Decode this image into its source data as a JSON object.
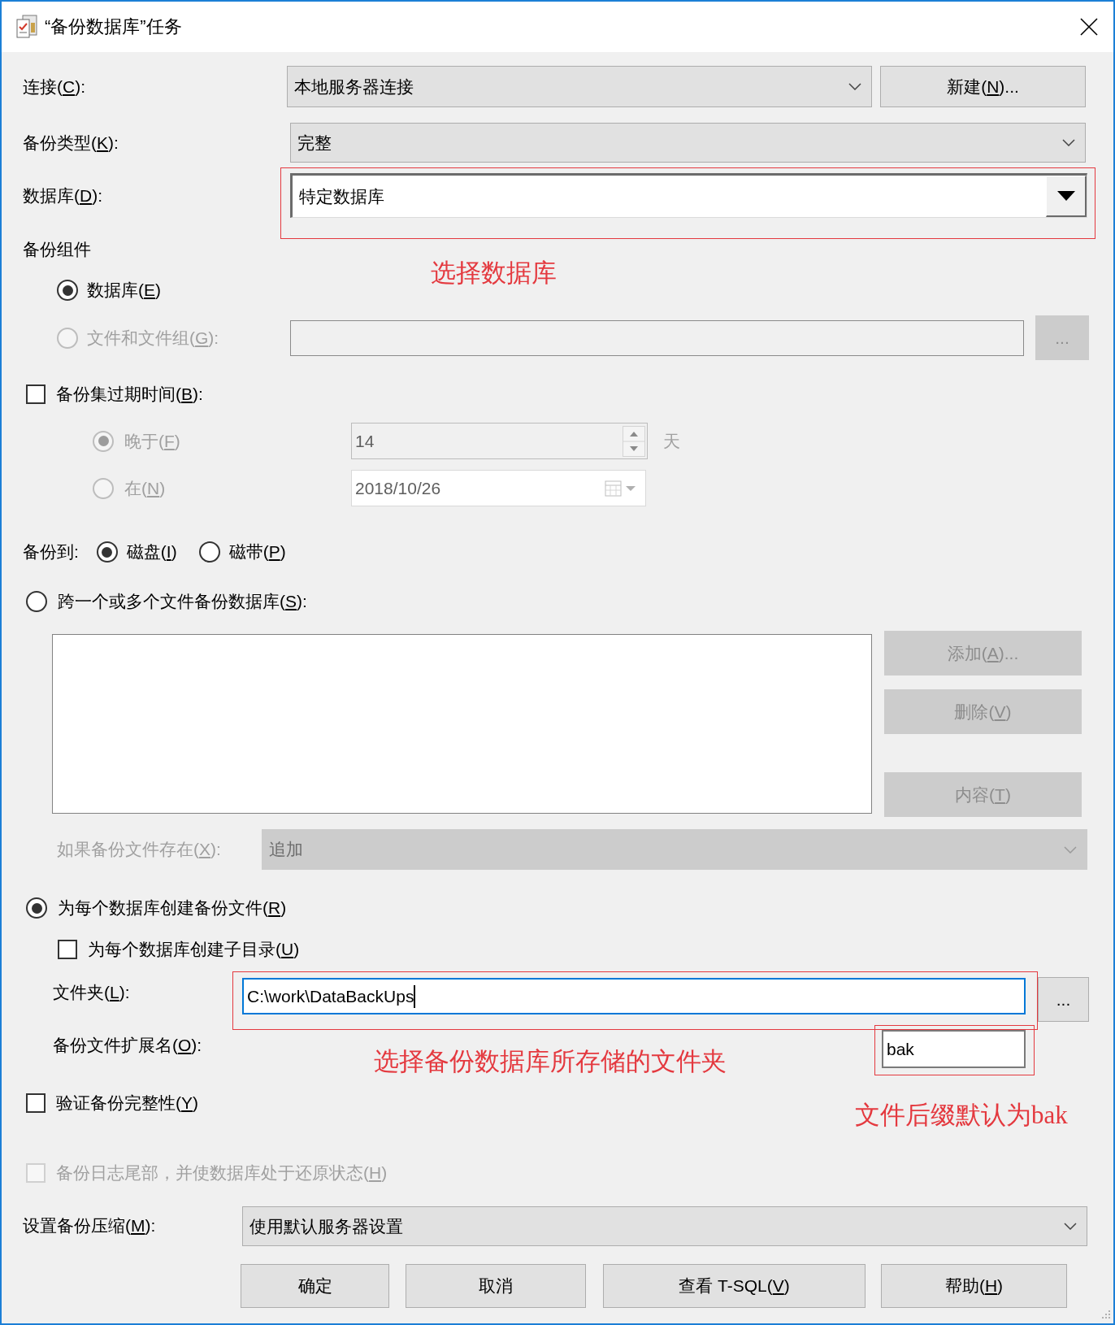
{
  "window": {
    "title": "“备份数据库”任务"
  },
  "connection": {
    "label": "连接(C):",
    "value": "本地服务器连接",
    "button": "新建(N)..."
  },
  "backup_type": {
    "label": "备份类型(K):",
    "value": "完整"
  },
  "database": {
    "label": "数据库(D):",
    "value": "特定数据库",
    "note": "选择数据库"
  },
  "backup_component": {
    "heading": "备份组件",
    "options": [
      {
        "label": "数据库(E)",
        "selected": true,
        "disabled": false
      },
      {
        "label": "文件和文件组(G):",
        "selected": false,
        "disabled": true
      }
    ],
    "browse_button": {
      "text": "...",
      "disabled": true
    }
  },
  "expiration": {
    "label": "备份集过期时间(B):",
    "checked": false,
    "options": [
      {
        "kind": "spinner",
        "label": "晚于(F)",
        "selected": true,
        "disabled": true,
        "value": "14",
        "unit": "天"
      },
      {
        "kind": "date",
        "label": "在(N)",
        "selected": false,
        "disabled": true,
        "value": "2018/10/26"
      }
    ]
  },
  "backup_to": {
    "label": "备份到:",
    "options": [
      {
        "label": "磁盘(I)",
        "selected": true
      },
      {
        "label": "磁带(P)",
        "selected": false
      }
    ]
  },
  "span_files": {
    "label": "跨一个或多个文件备份数据库(S):",
    "selected": false,
    "buttons": [
      {
        "text": "添加(A)...",
        "disabled": true
      },
      {
        "text": "删除(V)",
        "disabled": true
      },
      {
        "text": "内容(T)",
        "disabled": true
      }
    ],
    "if_exists": {
      "label": "如果备份文件存在(X):",
      "value": "追加",
      "disabled": true
    }
  },
  "per_database": {
    "label": "为每个数据库创建备份文件(R)",
    "selected": true,
    "subdirectory": {
      "label": "为每个数据库创建子目录(U)",
      "checked": false
    },
    "folder": {
      "label": "文件夹(L):",
      "value": "C:\\work\\DataBackUps",
      "focused": true,
      "note": "选择备份数据库所存储的文件夹"
    },
    "browse_button": {
      "text": "...",
      "disabled": false
    },
    "extension": {
      "label": "备份文件扩展名(O):",
      "value": "bak",
      "note": "文件后缀默认为bak"
    }
  },
  "verify": {
    "label": "验证备份完整性(Y)",
    "checked": false
  },
  "tail_log": {
    "label": "备份日志尾部，并使数据库处于还原状态(H)",
    "checked": false,
    "disabled": true
  },
  "compression": {
    "label": "设置备份压缩(M):",
    "value": "使用默认服务器设置"
  },
  "buttons": [
    {
      "text": "确定"
    },
    {
      "text": "取消"
    },
    {
      "text": "查看 T-SQL(V)"
    },
    {
      "text": "帮助(H)"
    }
  ]
}
